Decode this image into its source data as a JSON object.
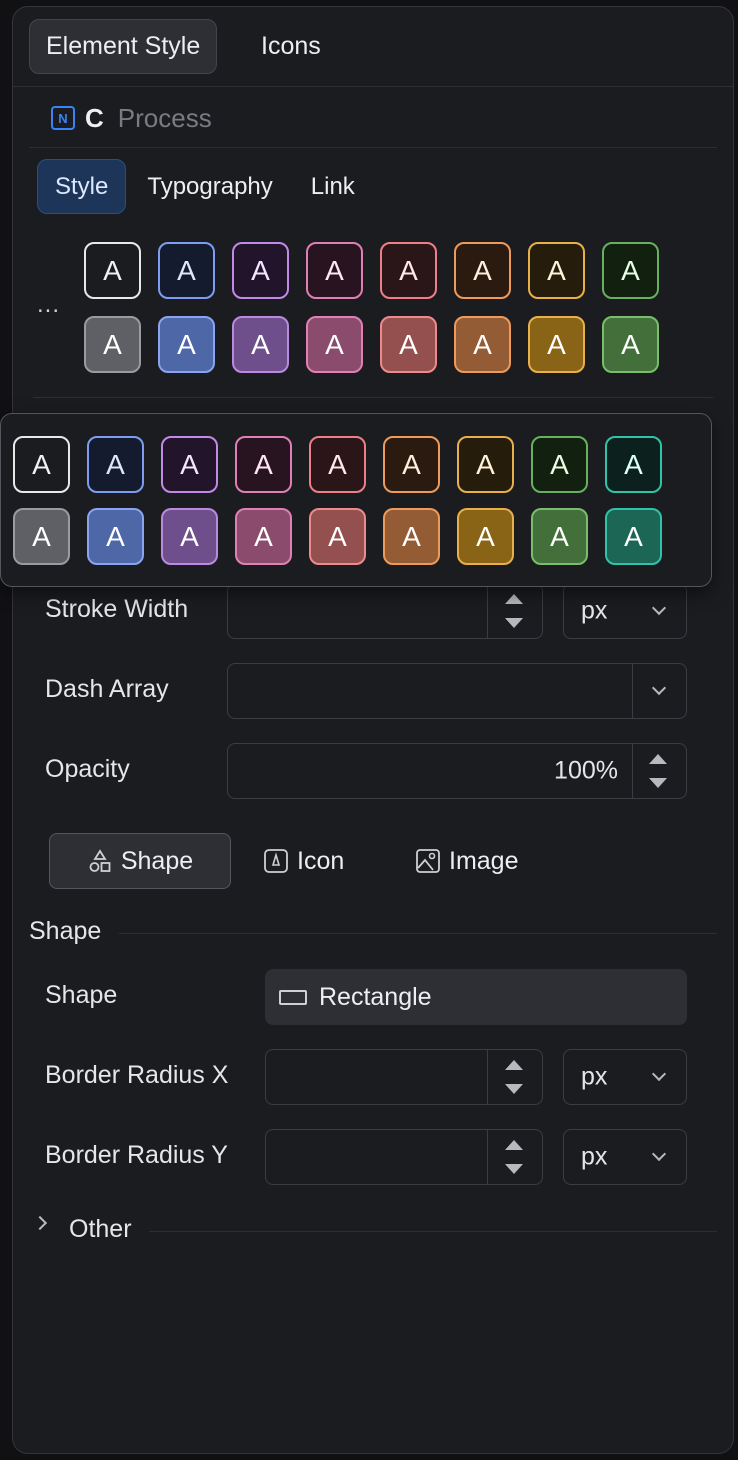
{
  "tabs": {
    "element_style": "Element Style",
    "icons": "Icons"
  },
  "breadcrumb": {
    "badge": "N",
    "letter": "C",
    "name": "Process"
  },
  "subtabs": [
    "Style",
    "Typography",
    "Link"
  ],
  "swatch_letter": "A",
  "more_label": "...",
  "swatches_top": [
    {
      "border": "#e8e8ea",
      "bg": "#1b1c20",
      "text": "#f0f0f0"
    },
    {
      "border": "#7f9df0",
      "bg": "#141b2e",
      "text": "#dfe6ff"
    },
    {
      "border": "#c28ae6",
      "bg": "#22142a",
      "text": "#f2e6ff"
    },
    {
      "border": "#e07fb5",
      "bg": "#281420",
      "text": "#ffe6f2"
    },
    {
      "border": "#ee7f86",
      "bg": "#2a1618",
      "text": "#ffe6e8"
    },
    {
      "border": "#ee9a5a",
      "bg": "#2a1a10",
      "text": "#ffeedd"
    },
    {
      "border": "#e8b04a",
      "bg": "#251c0c",
      "text": "#fff2d8"
    },
    {
      "border": "#68b060",
      "bg": "#12200f",
      "text": "#e6ffe2"
    }
  ],
  "swatches_bottom": [
    {
      "border": "#9a9aa0",
      "bg": "#5f6066",
      "text": "#ffffff"
    },
    {
      "border": "#8aa4f0",
      "bg": "#4e67a6",
      "text": "#ffffff"
    },
    {
      "border": "#b98ae0",
      "bg": "#6e4f8c",
      "text": "#ffffff"
    },
    {
      "border": "#e080b4",
      "bg": "#8a4b6c",
      "text": "#ffffff"
    },
    {
      "border": "#ee8a8e",
      "bg": "#94504f",
      "text": "#ffffff"
    },
    {
      "border": "#ee9a5a",
      "bg": "#945c34",
      "text": "#ffffff"
    },
    {
      "border": "#e8b04a",
      "bg": "#8a6416",
      "text": "#ffffff"
    },
    {
      "border": "#78be6c",
      "bg": "#436f3a",
      "text": "#ffffff"
    }
  ],
  "popup_top": [
    {
      "border": "#e8e8ea",
      "bg": "#1b1c20",
      "text": "#f0f0f0"
    },
    {
      "border": "#7f9df0",
      "bg": "#141b2e",
      "text": "#dfe6ff"
    },
    {
      "border": "#c28ae6",
      "bg": "#22142a",
      "text": "#f2e6ff"
    },
    {
      "border": "#e07fb5",
      "bg": "#281420",
      "text": "#ffe6f2"
    },
    {
      "border": "#ee7f86",
      "bg": "#2a1618",
      "text": "#ffe6e8"
    },
    {
      "border": "#ee9a5a",
      "bg": "#2a1a10",
      "text": "#ffeedd"
    },
    {
      "border": "#e8b04a",
      "bg": "#251c0c",
      "text": "#fff2d8"
    },
    {
      "border": "#68b060",
      "bg": "#12200f",
      "text": "#e6ffe2"
    },
    {
      "border": "#2fc4a8",
      "bg": "#0c211d",
      "text": "#dcfff7"
    }
  ],
  "popup_bottom": [
    {
      "border": "#9a9aa0",
      "bg": "#5f6066",
      "text": "#ffffff"
    },
    {
      "border": "#8aa4f0",
      "bg": "#4e67a6",
      "text": "#ffffff"
    },
    {
      "border": "#b98ae0",
      "bg": "#6e4f8c",
      "text": "#ffffff"
    },
    {
      "border": "#e080b4",
      "bg": "#8a4b6c",
      "text": "#ffffff"
    },
    {
      "border": "#ee8a8e",
      "bg": "#94504f",
      "text": "#ffffff"
    },
    {
      "border": "#ee9a5a",
      "bg": "#945c34",
      "text": "#ffffff"
    },
    {
      "border": "#e8b04a",
      "bg": "#8a6416",
      "text": "#ffffff"
    },
    {
      "border": "#78be6c",
      "bg": "#436f3a",
      "text": "#ffffff"
    },
    {
      "border": "#2fc4a8",
      "bg": "#1c6656",
      "text": "#ffffff"
    }
  ],
  "fields": {
    "stroke_width": {
      "label": "Stroke Width",
      "value": "",
      "unit": "px"
    },
    "dash_array": {
      "label": "Dash Array",
      "value": ""
    },
    "opacity": {
      "label": "Opacity",
      "value": "100%"
    }
  },
  "kind_buttons": {
    "shape": "Shape",
    "icon": "Icon",
    "image": "Image"
  },
  "shape_section": {
    "title": "Shape",
    "shape_label": "Shape",
    "shape_value": "Rectangle",
    "radius_x": {
      "label": "Border Radius X",
      "value": "",
      "unit": "px"
    },
    "radius_y": {
      "label": "Border Radius Y",
      "value": "",
      "unit": "px"
    }
  },
  "other_section": {
    "title": "Other"
  }
}
